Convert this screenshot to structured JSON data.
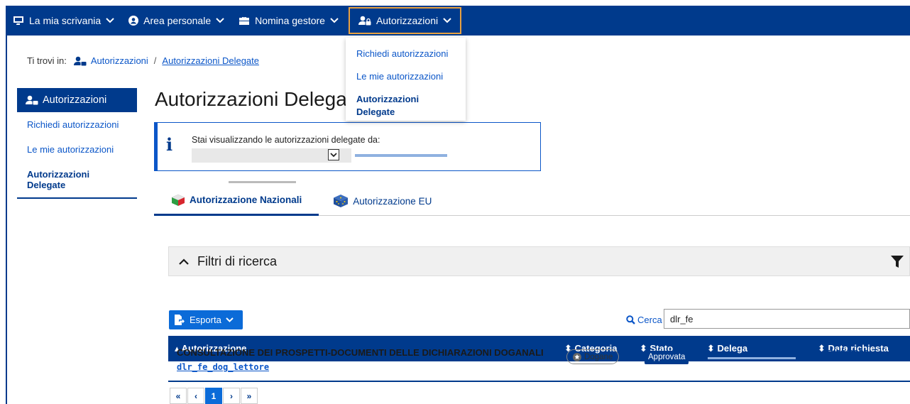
{
  "nav": {
    "items": [
      {
        "label": "La mia scrivania"
      },
      {
        "label": "Area personale"
      },
      {
        "label": "Nomina gestore"
      },
      {
        "label": "Autorizzazioni"
      }
    ]
  },
  "dropdown": {
    "items": [
      {
        "label": "Richiedi autorizzazioni"
      },
      {
        "label": "Le mie autorizzazioni"
      },
      {
        "label": "Autorizzazioni Delegate"
      }
    ]
  },
  "breadcrumb": {
    "prefix": "Ti trovi in:",
    "item1": "Autorizzazioni",
    "separator": "/",
    "item2": "Autorizzazioni Delegate"
  },
  "sidebar": {
    "title": "Autorizzazioni",
    "items": [
      {
        "label": "Richiedi autorizzazioni"
      },
      {
        "label": "Le mie autorizzazioni"
      },
      {
        "label": "Autorizzazioni Delegate"
      }
    ]
  },
  "page": {
    "title": "Autorizzazioni Delegate"
  },
  "info": {
    "text": "Stai visualizzando le autorizzazioni delegate da:"
  },
  "tabs": [
    {
      "label": "Autorizzazione Nazionali"
    },
    {
      "label": "Autorizzazione EU"
    }
  ],
  "filters": {
    "label": "Filtri di ricerca"
  },
  "toolbar": {
    "export_label": "Esporta",
    "search_label": "Cerca",
    "search_value": "dlr_fe"
  },
  "table": {
    "headers": {
      "autorizzazione": "Autorizzazione",
      "categoria": "Categoria",
      "stato": "Stato",
      "delega": "Delega",
      "data": "Data richiesta"
    },
    "rows": [
      {
        "description": "CONSULTAZIONE DEI PROSPETTI-DOCUMENTI DELLE DICHIARAZIONI DOGANALI",
        "code": "dlr_fe_dog_lettore",
        "categoria": "Dogane",
        "stato": "Approvata",
        "data": "07/09/2022"
      }
    ]
  },
  "pagination": {
    "first": "«",
    "prev": "‹",
    "current": "1",
    "next": "›",
    "last": "»"
  },
  "colors": {
    "primary": "#003a8c",
    "accent": "#0b6bd8",
    "highlight": "#e8a040"
  }
}
